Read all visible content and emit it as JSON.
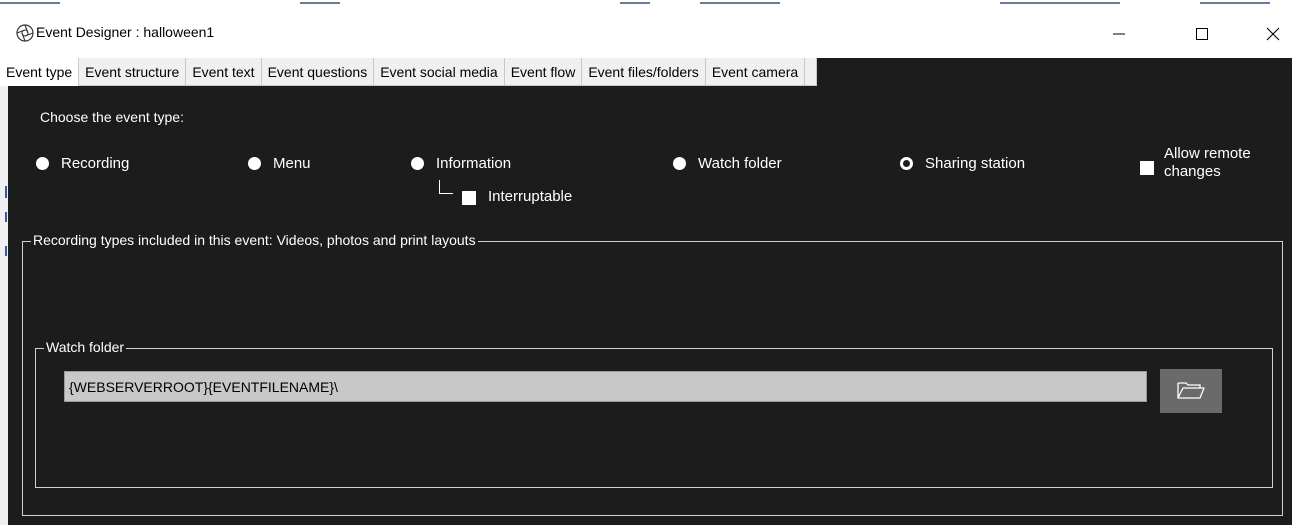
{
  "window": {
    "title": "Event Designer : halloween1",
    "controls": [
      "minimize",
      "maximize",
      "close"
    ]
  },
  "tabs": [
    {
      "label": "Event type",
      "active": true
    },
    {
      "label": "Event structure",
      "active": false
    },
    {
      "label": "Event text",
      "active": false
    },
    {
      "label": "Event questions",
      "active": false
    },
    {
      "label": "Event social media",
      "active": false
    },
    {
      "label": "Event flow",
      "active": false
    },
    {
      "label": "Event files/folders",
      "active": false
    },
    {
      "label": "Event camera",
      "active": false
    }
  ],
  "event_type": {
    "prompt": "Choose the event type:",
    "options": [
      {
        "label": "Recording",
        "selected": false
      },
      {
        "label": "Menu",
        "selected": false
      },
      {
        "label": "Information",
        "selected": false
      },
      {
        "label": "Watch folder",
        "selected": false
      },
      {
        "label": "Sharing station",
        "selected": true
      }
    ],
    "interruptable": {
      "label": "Interruptable",
      "checked": false
    },
    "allow_remote_changes": {
      "label_line1": "Allow remote",
      "label_line2": "changes",
      "checked": false
    }
  },
  "recording_group": {
    "legend": "Recording types included in this event:  Videos, photos and print layouts"
  },
  "watch_folder": {
    "legend": "Watch folder",
    "path": "{WEBSERVERROOT}{EVENTFILENAME}\\"
  },
  "colors": {
    "background": "#1c1c1c",
    "titlebar": "#ffffff",
    "input_bg": "#c8c8c8",
    "browse_button": "#6a6a6a"
  },
  "icons": {
    "app": "aperture-icon",
    "browse": "folder-open-icon"
  }
}
